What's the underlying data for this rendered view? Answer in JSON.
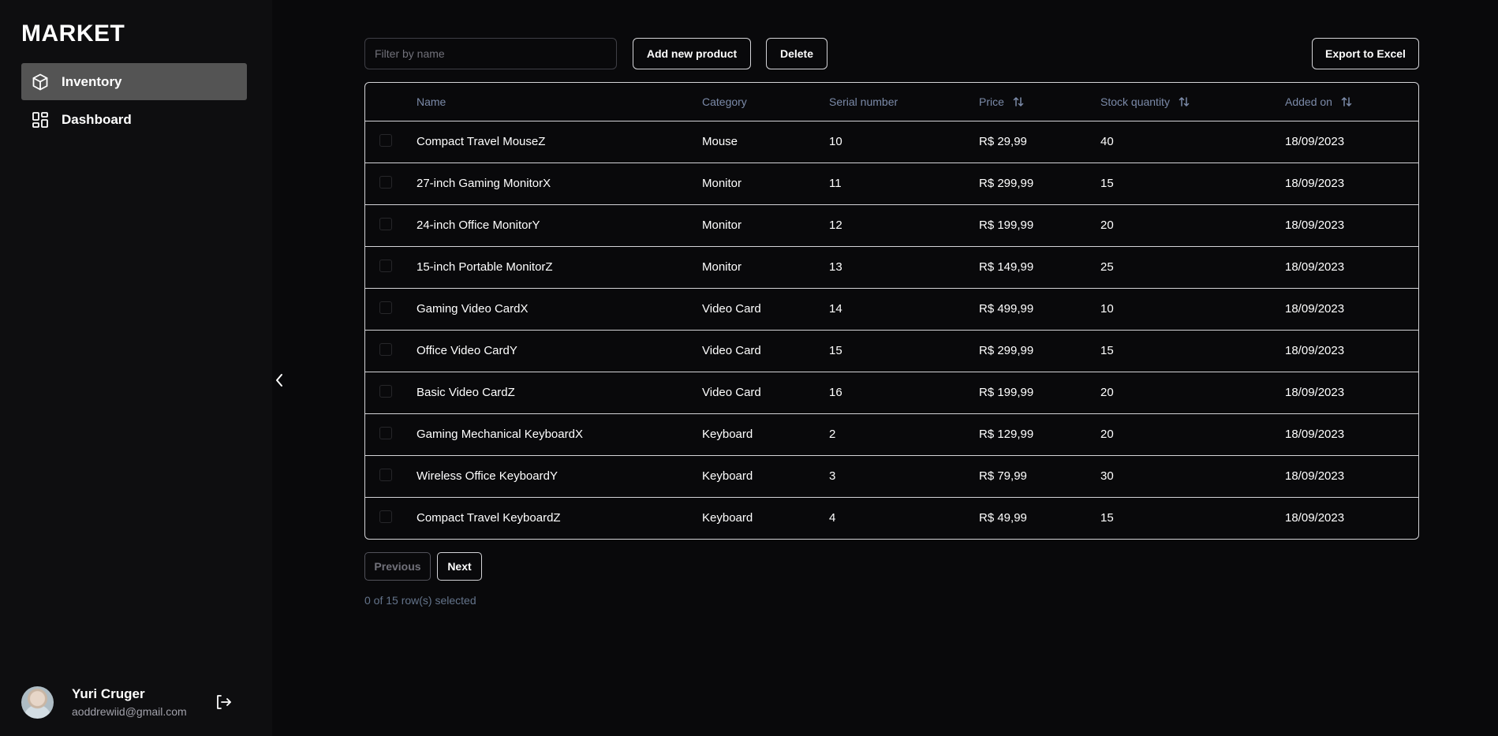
{
  "app": {
    "brand": "MARKET"
  },
  "sidebar": {
    "items": [
      {
        "label": "Inventory",
        "icon": "box-icon",
        "active": true
      },
      {
        "label": "Dashboard",
        "icon": "layout-dashboard-icon",
        "active": false
      }
    ]
  },
  "user": {
    "name": "Yuri Cruger",
    "email": "aoddrewiid@gmail.com"
  },
  "toolbar": {
    "filter_placeholder": "Filter by name",
    "filter_value": "",
    "add_label": "Add new product",
    "delete_label": "Delete",
    "export_label": "Export to Excel"
  },
  "table": {
    "columns": {
      "name": "Name",
      "category": "Category",
      "serial": "Serial number",
      "price": "Price",
      "stock": "Stock quantity",
      "added": "Added on"
    },
    "rows": [
      {
        "name": "Compact Travel MouseZ",
        "category": "Mouse",
        "serial": "10",
        "price": "R$ 29,99",
        "stock": "40",
        "added": "18/09/2023"
      },
      {
        "name": "27-inch Gaming MonitorX",
        "category": "Monitor",
        "serial": "11",
        "price": "R$ 299,99",
        "stock": "15",
        "added": "18/09/2023"
      },
      {
        "name": "24-inch Office MonitorY",
        "category": "Monitor",
        "serial": "12",
        "price": "R$ 199,99",
        "stock": "20",
        "added": "18/09/2023"
      },
      {
        "name": "15-inch Portable MonitorZ",
        "category": "Monitor",
        "serial": "13",
        "price": "R$ 149,99",
        "stock": "25",
        "added": "18/09/2023"
      },
      {
        "name": "Gaming Video CardX",
        "category": "Video Card",
        "serial": "14",
        "price": "R$ 499,99",
        "stock": "10",
        "added": "18/09/2023"
      },
      {
        "name": "Office Video CardY",
        "category": "Video Card",
        "serial": "15",
        "price": "R$ 299,99",
        "stock": "15",
        "added": "18/09/2023"
      },
      {
        "name": "Basic Video CardZ",
        "category": "Video Card",
        "serial": "16",
        "price": "R$ 199,99",
        "stock": "20",
        "added": "18/09/2023"
      },
      {
        "name": "Gaming Mechanical KeyboardX",
        "category": "Keyboard",
        "serial": "2",
        "price": "R$ 129,99",
        "stock": "20",
        "added": "18/09/2023"
      },
      {
        "name": "Wireless Office KeyboardY",
        "category": "Keyboard",
        "serial": "3",
        "price": "R$ 79,99",
        "stock": "30",
        "added": "18/09/2023"
      },
      {
        "name": "Compact Travel KeyboardZ",
        "category": "Keyboard",
        "serial": "4",
        "price": "R$ 49,99",
        "stock": "15",
        "added": "18/09/2023"
      }
    ]
  },
  "pagination": {
    "previous_label": "Previous",
    "next_label": "Next",
    "previous_disabled": true
  },
  "selection": {
    "text": "0 of 15 row(s) selected"
  },
  "colors": {
    "background": "#09090b",
    "sidebar": "#0e0e10",
    "active_nav": "#545454",
    "border": "#d4d4d8",
    "muted_header": "#7b8aa8"
  }
}
